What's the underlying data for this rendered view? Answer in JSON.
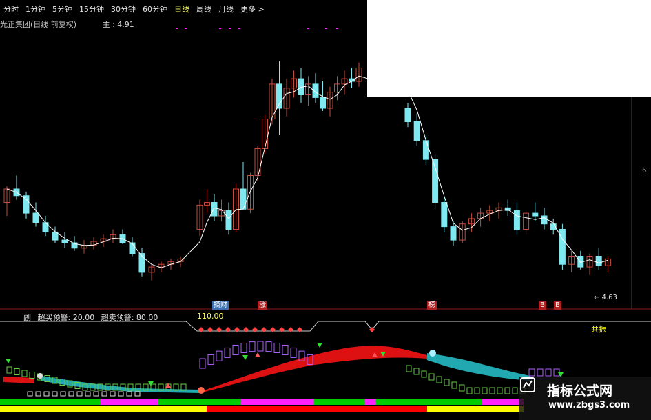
{
  "toolbar": {
    "items": [
      "分时",
      "1分钟",
      "5分钟",
      "15分钟",
      "30分钟",
      "60分钟",
      "日线",
      "周线",
      "月线",
      "更多 >"
    ],
    "active_index": 6
  },
  "header": {
    "stock_title": "光正集团(日线 前复权)",
    "main_label": "主 : 4.91"
  },
  "price_label": "← 4.63",
  "side_label": "6",
  "tags": {
    "zhaicai": "摘财",
    "zhang": "涨",
    "bang": "榜",
    "b1": "B",
    "b2": "B"
  },
  "sub": {
    "prefix": "副",
    "oversold": "超买预警: 20.00",
    "overbought": "超卖预警: 80.00",
    "level": "110.00",
    "resonance": "共振"
  },
  "watermark": {
    "title": "指标公式网",
    "url": "www.zbgs3.com"
  },
  "colors": {
    "background": "#000000",
    "up_candle": "#c84a3a",
    "down_candle": "#7fe8f0",
    "ma_line": "#ffffff",
    "red_band": "#dd1111",
    "cyan_band": "#22a8b0",
    "purple_box": "#b060ff",
    "green_box": "#66cc44",
    "magenta_bar": "#ff22ff",
    "yellow_bar": "#ffff00",
    "green_bar": "#00cc00",
    "red_bar": "#ff0000"
  },
  "chart_data": {
    "type": "candlestick",
    "title": "光正集团(日线 前复权)",
    "candles": [
      [
        5.1,
        5.22,
        5.0,
        5.2
      ],
      [
        5.2,
        5.3,
        5.12,
        5.15
      ],
      [
        5.15,
        5.18,
        4.98,
        5.02
      ],
      [
        5.02,
        5.1,
        4.92,
        4.95
      ],
      [
        4.95,
        5.0,
        4.85,
        4.88
      ],
      [
        4.88,
        4.92,
        4.8,
        4.82
      ],
      [
        4.82,
        4.88,
        4.76,
        4.8
      ],
      [
        4.8,
        4.85,
        4.74,
        4.76
      ],
      [
        4.76,
        4.82,
        4.72,
        4.78
      ],
      [
        4.78,
        4.84,
        4.75,
        4.81
      ],
      [
        4.81,
        4.86,
        4.77,
        4.83
      ],
      [
        4.83,
        4.9,
        4.8,
        4.86
      ],
      [
        4.86,
        4.9,
        4.79,
        4.8
      ],
      [
        4.8,
        4.84,
        4.7,
        4.72
      ],
      [
        4.72,
        4.76,
        4.55,
        4.58
      ],
      [
        4.58,
        4.64,
        4.52,
        4.62
      ],
      [
        4.62,
        4.66,
        4.58,
        4.64
      ],
      [
        4.64,
        4.68,
        4.6,
        4.66
      ],
      [
        4.66,
        4.7,
        4.62,
        4.68
      ],
      [
        4.9,
        5.12,
        4.85,
        5.08
      ],
      [
        5.08,
        5.2,
        5.02,
        5.1
      ],
      [
        5.1,
        5.16,
        4.96,
        5.0
      ],
      [
        5.0,
        5.12,
        4.96,
        5.04
      ],
      [
        5.04,
        5.1,
        4.86,
        4.9
      ],
      [
        4.9,
        5.24,
        4.88,
        5.2
      ],
      [
        5.2,
        5.4,
        5.15,
        5.05
      ],
      [
        5.05,
        5.32,
        5.02,
        5.3
      ],
      [
        5.3,
        5.52,
        5.26,
        5.5
      ],
      [
        5.5,
        5.75,
        5.46,
        5.72
      ],
      [
        5.72,
        6.02,
        5.68,
        5.98
      ],
      [
        5.98,
        6.15,
        5.6,
        5.8
      ],
      [
        5.8,
        6.02,
        5.74,
        5.95
      ],
      [
        5.95,
        6.08,
        5.88,
        6.02
      ],
      [
        6.02,
        6.1,
        5.84,
        5.9
      ],
      [
        5.9,
        6.04,
        5.82,
        5.98
      ],
      [
        5.98,
        6.06,
        5.84,
        5.88
      ],
      [
        5.88,
        6.0,
        5.78,
        5.8
      ],
      [
        5.8,
        5.96,
        5.74,
        5.92
      ],
      [
        5.92,
        6.04,
        5.86,
        5.98
      ],
      [
        5.98,
        6.08,
        5.9,
        6.02
      ],
      [
        6.02,
        6.1,
        5.95,
        6.0
      ],
      [
        6.0,
        6.14,
        5.96,
        6.1
      ],
      [
        5.8,
        5.84,
        5.66,
        5.7
      ],
      [
        5.7,
        5.76,
        5.52,
        5.56
      ],
      [
        5.56,
        5.6,
        5.38,
        5.42
      ],
      [
        5.42,
        5.46,
        5.05,
        5.1
      ],
      [
        5.1,
        5.14,
        4.88,
        4.92
      ],
      [
        4.92,
        4.96,
        4.78,
        4.82
      ],
      [
        4.82,
        4.96,
        4.8,
        4.94
      ],
      [
        4.94,
        5.02,
        4.88,
        4.98
      ],
      [
        4.98,
        5.06,
        4.92,
        5.02
      ],
      [
        5.02,
        5.08,
        4.96,
        5.04
      ],
      [
        5.04,
        5.1,
        4.98,
        5.06
      ],
      [
        5.06,
        5.12,
        5.0,
        5.04
      ],
      [
        5.04,
        5.1,
        4.86,
        4.9
      ],
      [
        4.9,
        5.04,
        4.86,
        5.02
      ],
      [
        5.02,
        5.1,
        4.96,
        5.0
      ],
      [
        5.0,
        5.06,
        4.9,
        4.94
      ],
      [
        4.94,
        4.98,
        4.86,
        4.9
      ],
      [
        4.9,
        4.94,
        4.6,
        4.64
      ],
      [
        4.64,
        4.74,
        4.58,
        4.7
      ],
      [
        4.7,
        4.74,
        4.6,
        4.62
      ],
      [
        4.62,
        4.72,
        4.56,
        4.7
      ],
      [
        4.7,
        4.76,
        4.6,
        4.63
      ],
      [
        4.63,
        4.7,
        4.58,
        4.68
      ]
    ],
    "value_range": [
      4.4,
      6.4
    ],
    "note_markers": [
      "摘财",
      "涨",
      "榜",
      "B",
      "B"
    ]
  }
}
